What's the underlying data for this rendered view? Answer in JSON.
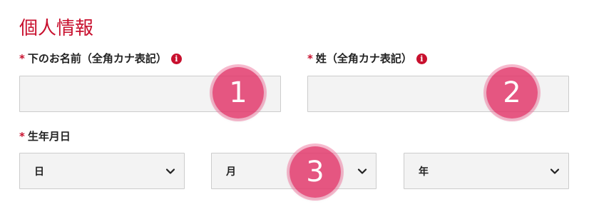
{
  "section": {
    "title": "個人情報"
  },
  "fields": {
    "first_name_kana": {
      "required": "*",
      "label": "下のお名前（全角カナ表記）",
      "info_icon": "i",
      "value": ""
    },
    "last_name_kana": {
      "required": "*",
      "label": "姓（全角カナ表記）",
      "info_icon": "i",
      "value": ""
    },
    "birthdate": {
      "required": "*",
      "label": "生年月日",
      "day_value": "日",
      "month_value": "月",
      "year_value": "年"
    }
  },
  "badges": [
    "1",
    "2",
    "3"
  ],
  "colors": {
    "accent": "#c8102e",
    "badge": "#e23b6e",
    "input_bg": "#f3f3f3",
    "input_border": "#cccccc"
  },
  "icons": {
    "info": "info-icon",
    "chevron": "chevron-down-icon"
  }
}
